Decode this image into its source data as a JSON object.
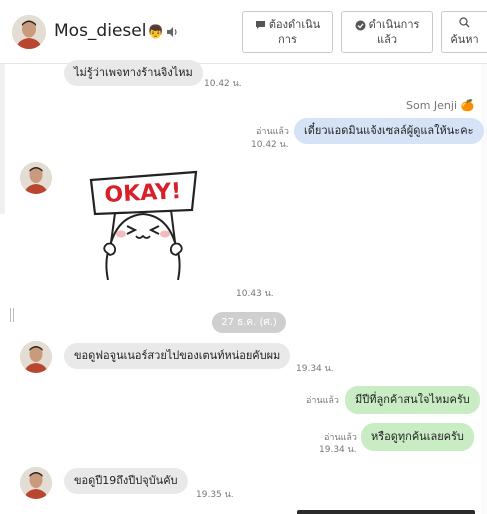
{
  "header": {
    "contact_name": "Mos_diesel",
    "contact_emoji": "👦",
    "buttons": [
      {
        "line1": "ต้องดำเนิน",
        "line2": "การ"
      },
      {
        "line1": "ดำเนินการ",
        "line2": "แล้ว"
      },
      {
        "line1": "",
        "line2": "ค้นหา"
      }
    ]
  },
  "messages": {
    "m1": {
      "text": "ไม่รู้ว่าเพจทางร้านจิงไหม",
      "time": "10.42 น."
    },
    "agent_name": "Som Jenji",
    "agent_emoji": "🍊",
    "m2": {
      "text": "เดี๋ยวแอดมินแจ้งเซลล์ผู้ดูแลให้นะคะ",
      "read": "อ่านแล้ว",
      "time": "10.42 น."
    },
    "sticker": {
      "sign_text": "OKAY!",
      "time": "10.43 น."
    },
    "date": "27 ธ.ค. (ศ.)",
    "m3": {
      "text": "ขอดูฟอจูนเนอร์สวยไปของเตนท์หน่อยคับผม",
      "time": "19.34 น."
    },
    "m4": {
      "text": "มีปีที่ลูกค้าสนใจไหมครับ",
      "read": "อ่านแล้ว"
    },
    "m5": {
      "text": "หรือดูทุกค้นเลยครับ",
      "read": "อ่านแล้ว",
      "time": "19.34 น."
    },
    "m6": {
      "text": "ขอดูปี19ถึงปีปจุบันคับ",
      "time": "19.35 น."
    }
  }
}
